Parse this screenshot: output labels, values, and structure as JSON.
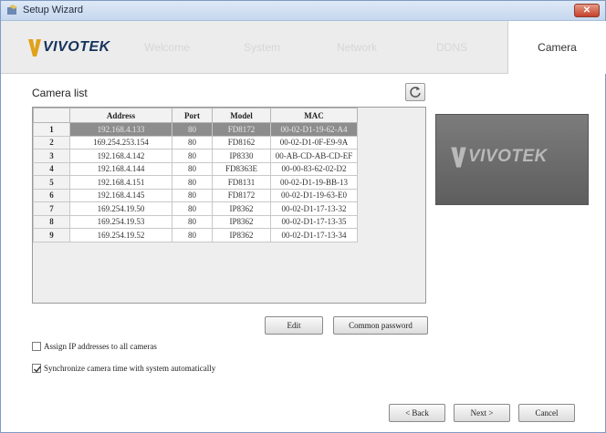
{
  "window": {
    "title": "Setup Wizard"
  },
  "brand": {
    "name": "VIVOTEK"
  },
  "steps": [
    "Welcome",
    "System",
    "Network",
    "DDNS",
    "Camera"
  ],
  "active_step": "Camera",
  "section_title": "Camera list",
  "table": {
    "columns": [
      "",
      "Address",
      "Port",
      "Model",
      "MAC"
    ],
    "rows": [
      {
        "index": "1",
        "address": "192.168.4.133",
        "port": "80",
        "model": "FD8172",
        "mac": "00-02-D1-19-62-A4",
        "selected": true
      },
      {
        "index": "2",
        "address": "169.254.253.154",
        "port": "80",
        "model": "FD8162",
        "mac": "00-02-D1-0F-E9-9A"
      },
      {
        "index": "3",
        "address": "192.168.4.142",
        "port": "80",
        "model": "IP8330",
        "mac": "00-AB-CD-AB-CD-EF"
      },
      {
        "index": "4",
        "address": "192.168.4.144",
        "port": "80",
        "model": "FD8363E",
        "mac": "00-00-83-62-02-D2"
      },
      {
        "index": "5",
        "address": "192.168.4.151",
        "port": "80",
        "model": "FD8131",
        "mac": "00-02-D1-19-BB-13"
      },
      {
        "index": "6",
        "address": "192.168.4.145",
        "port": "80",
        "model": "FD8172",
        "mac": "00-02-D1-19-63-E0"
      },
      {
        "index": "7",
        "address": "169.254.19.50",
        "port": "80",
        "model": "IP8362",
        "mac": "00-02-D1-17-13-32"
      },
      {
        "index": "8",
        "address": "169.254.19.53",
        "port": "80",
        "model": "IP8362",
        "mac": "00-02-D1-17-13-35"
      },
      {
        "index": "9",
        "address": "169.254.19.52",
        "port": "80",
        "model": "IP8362",
        "mac": "00-02-D1-17-13-34"
      }
    ]
  },
  "buttons": {
    "edit": "Edit",
    "common_password": "Common password",
    "back": "< Back",
    "next": "Next >",
    "cancel": "Cancel"
  },
  "options": {
    "assign_ip": {
      "label": "Assign IP addresses to all cameras",
      "checked": false
    },
    "sync_time": {
      "label": "Synchronize camera time with system automatically",
      "checked": true
    }
  },
  "colors": {
    "brand_blue": "#16335c",
    "selected_row": "#8d8d8d",
    "close_red": "#c6412a"
  }
}
